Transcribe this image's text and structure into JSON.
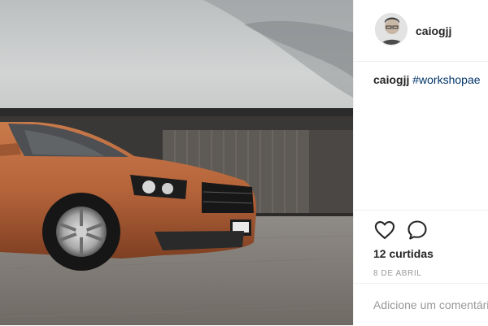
{
  "post": {
    "username": "caiogjj",
    "caption_user": "caiogjj",
    "caption_hashtag": "#workshopae",
    "likes": "12 curtidas",
    "date": "8 DE ABRIL",
    "comment_placeholder": "Adicione um comentário..."
  },
  "icons": {
    "like": "heart-icon",
    "comment": "speech-bubble-icon"
  },
  "colors": {
    "hashtag": "#003569",
    "car_body": "#b5643a",
    "border": "#efefef"
  }
}
